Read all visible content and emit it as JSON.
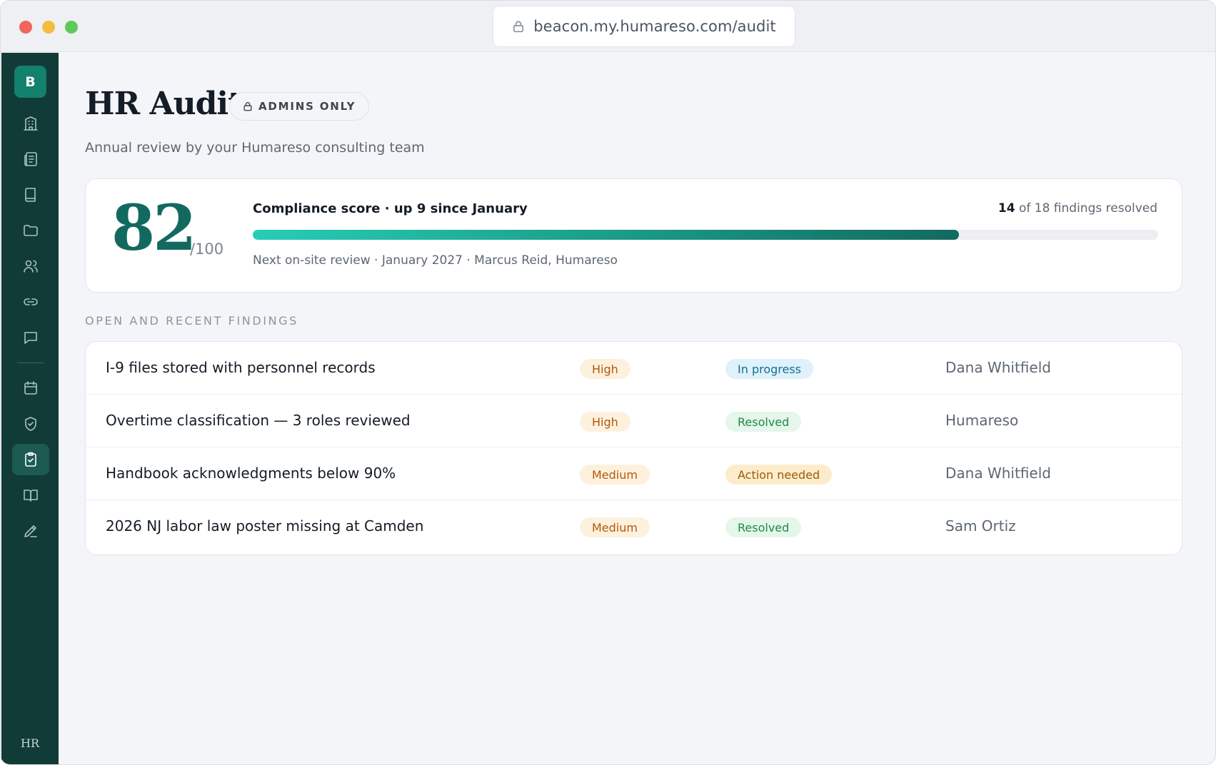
{
  "browser": {
    "url": "beacon.my.humareso.com/audit"
  },
  "sidebar": {
    "logo_letter": "B",
    "items": [
      {
        "icon": "building-icon",
        "active": false
      },
      {
        "icon": "news-icon",
        "active": false
      },
      {
        "icon": "book-icon",
        "active": false
      },
      {
        "icon": "folder-icon",
        "active": false
      },
      {
        "icon": "users-icon",
        "active": false
      },
      {
        "icon": "link-icon",
        "active": false
      },
      {
        "icon": "message-icon",
        "active": false
      },
      {
        "icon": "calendar-icon",
        "active": false
      },
      {
        "icon": "shield-icon",
        "active": false
      },
      {
        "icon": "clipboard-check-icon",
        "active": true
      },
      {
        "icon": "open-book-icon",
        "active": false
      },
      {
        "icon": "pen-icon",
        "active": false
      }
    ],
    "footer_mark": "HR"
  },
  "header": {
    "title": "HR Audit",
    "badge": "ADMINS ONLY",
    "subtitle": "Annual review by your Humareso consulting team"
  },
  "score": {
    "value": "82",
    "max": "/100",
    "label": "Compliance score · up 9 since January",
    "resolved_count": "14",
    "resolved_suffix": "of 18 findings resolved",
    "progress_fraction": 0.78,
    "next_review": "Next on-site review · January 2027 · Marcus Reid, Humareso"
  },
  "findings": {
    "section_label": "OPEN AND RECENT FINDINGS",
    "rows": [
      {
        "title": "I-9 files stored with personnel records",
        "severity": "High",
        "status": "In progress",
        "owner": "Dana Whitfield"
      },
      {
        "title": "Overtime classification — 3 roles reviewed",
        "severity": "High",
        "status": "Resolved",
        "owner": "Humareso"
      },
      {
        "title": "Handbook acknowledgments below 90%",
        "severity": "Medium",
        "status": "Action needed",
        "owner": "Dana Whitfield"
      },
      {
        "title": "2026 NJ labor law poster missing at Camden",
        "severity": "Medium",
        "status": "Resolved",
        "owner": "Sam Ortiz"
      }
    ]
  },
  "colors": {
    "sidebar": "#113b36",
    "accent": "#13695f",
    "severity_bg": "#fdf1de",
    "severity_text": "#b4580e",
    "status_in_progress_bg": "#dff1fa",
    "status_in_progress_text": "#12708f",
    "status_resolved_bg": "#e5f6ea",
    "status_resolved_text": "#1f8a45",
    "status_action_bg": "#fdeccb",
    "status_action_text": "#9a5a08"
  }
}
